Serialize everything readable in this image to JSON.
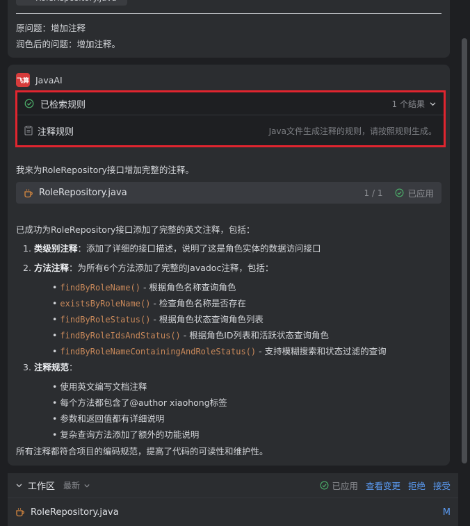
{
  "previous_message": {
    "file_tab": "RoleRepository.java",
    "original_question": "原问题：增加注释",
    "polished_question": "润色后的问题：增加注释。"
  },
  "assistant": {
    "logo_text": "飞算",
    "name": "JavaAI"
  },
  "rules_panel": {
    "title": "已检索规则",
    "result_count": "1 个结果",
    "rule_name": "注释规则",
    "rule_description": "Java文件生成注释的规则，请按照规则生成。"
  },
  "response": {
    "intro": "我来为RoleRepository接口增加完整的注释。",
    "file_card": {
      "file_name": "RoleRepository.java",
      "progress": "1 / 1",
      "status": "已应用"
    },
    "summary": "已成功为RoleRepository接口添加了完整的英文注释，包括：",
    "items": [
      {
        "num": "1.",
        "bold": "类级别注释",
        "text": "：添加了详细的接口描述，说明了这是角色实体的数据访问接口"
      },
      {
        "num": "2.",
        "bold": "方法注释",
        "text": "：为所有6个方法添加了完整的Javadoc注释，包括："
      },
      {
        "num": "3.",
        "bold": "注释规范",
        "text": "："
      }
    ],
    "methods": [
      {
        "code": "findByRoleName()",
        "text": " - 根据角色名称查询角色"
      },
      {
        "code": "existsByRoleName()",
        "text": " - 检查角色名称是否存在"
      },
      {
        "code": "findByRoleStatus()",
        "text": " - 根据角色状态查询角色列表"
      },
      {
        "code": "findByRoleIdsAndStatus()",
        "text": " - 根据角色ID列表和活跃状态查询角色"
      },
      {
        "code": "findByRoleNameContainingAndRoleStatus()",
        "text": " - 支持模糊搜索和状态过滤的查询"
      }
    ],
    "conventions": [
      "使用英文编写文档注释",
      "每个方法都包含了@author xiaohong标签",
      "参数和返回值都有详细说明",
      "复杂查询方法添加了额外的功能说明"
    ],
    "conclusion": "所有注释都符合项目的编码规范，提高了代码的可读性和维护性。"
  },
  "workspace": {
    "title": "工作区",
    "sort_label": "最新",
    "applied_label": "已应用",
    "view_changes": "查看变更",
    "reject": "拒绝",
    "accept": "接受",
    "file_name": "RoleRepository.java",
    "file_status": "M"
  },
  "colors": {
    "background": "#1e1f22",
    "panel": "#2b2d30",
    "highlight_border": "#e0252f",
    "code_orange": "#c9895a",
    "link_blue": "#5b9cf5",
    "success_green": "#4caf6a"
  }
}
